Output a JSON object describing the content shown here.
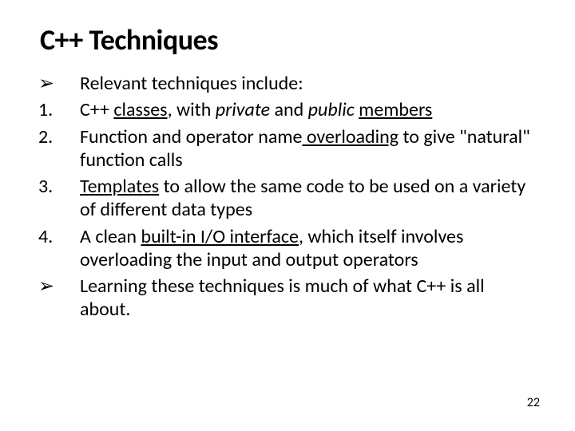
{
  "title": "C++ Techniques",
  "items": [
    {
      "marker": "➢"
    },
    {
      "marker": "1."
    },
    {
      "marker": "2."
    },
    {
      "marker": "3."
    },
    {
      "marker": "4."
    },
    {
      "marker": "➢"
    }
  ],
  "text": {
    "intro": "Relevant techniques include:",
    "i1_pre": "C++ ",
    "i1_classes": "classes",
    "i1_mid1": ", with ",
    "i1_private": "private",
    "i1_mid2": " and ",
    "i1_public": "public",
    "i1_sp": " ",
    "i1_members": "members",
    "i2_pre": "Function and operator name",
    "i2_ov": " overloading",
    "i2_post": " to give \"natural\" function calls",
    "i3_tpl": "Templates",
    "i3_post": " to allow the same code to be used on a variety of different data types",
    "i4_pre": "A clean ",
    "i4_io": "built-in I/O interface",
    "i4_post": ", which itself involves overloading the input and output operators",
    "outro": "Learning these techniques is much of what C++ is all about."
  },
  "page_number": "22"
}
